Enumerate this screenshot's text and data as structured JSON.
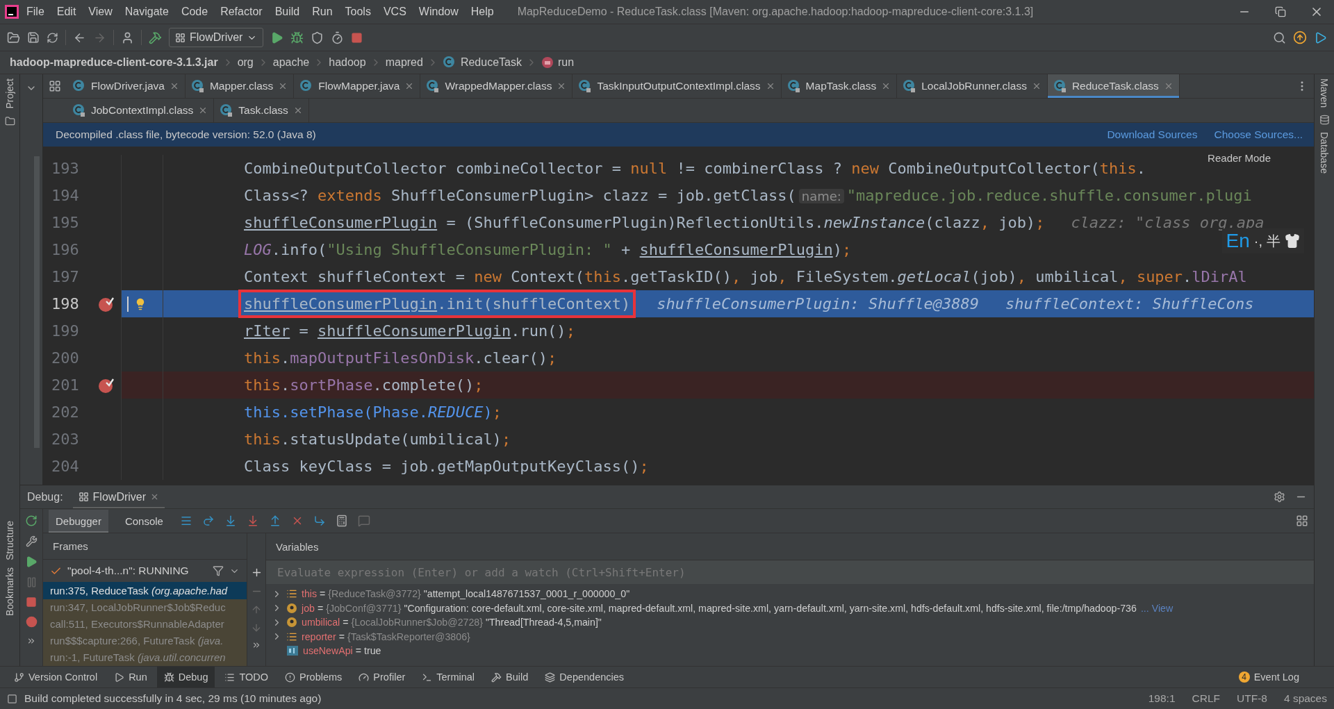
{
  "window": {
    "title": "MapReduceDemo - ReduceTask.class [Maven: org.apache.hadoop:hadoop-mapreduce-client-core:3.1.3]"
  },
  "menu": [
    "File",
    "Edit",
    "View",
    "Navigate",
    "Code",
    "Refactor",
    "Build",
    "Run",
    "Tools",
    "VCS",
    "Window",
    "Help"
  ],
  "toolbar": {
    "run_config": "FlowDriver"
  },
  "breadcrumb": [
    {
      "text": "hadoop-mapreduce-client-core-3.1.3.jar",
      "kind": "jar"
    },
    {
      "text": "org",
      "kind": "package"
    },
    {
      "text": "apache",
      "kind": "package"
    },
    {
      "text": "hadoop",
      "kind": "package"
    },
    {
      "text": "mapred",
      "kind": "package"
    },
    {
      "text": "ReduceTask",
      "kind": "class"
    },
    {
      "text": "run",
      "kind": "method"
    }
  ],
  "tab_rows": [
    [
      {
        "label": "FlowDriver.java",
        "kind": "java",
        "selected": false
      },
      {
        "label": "Mapper.class",
        "kind": "class",
        "selected": false
      },
      {
        "label": "FlowMapper.java",
        "kind": "java",
        "selected": false
      },
      {
        "label": "WrappedMapper.class",
        "kind": "class",
        "selected": false
      },
      {
        "label": "TaskInputOutputContextImpl.class",
        "kind": "class",
        "selected": false
      },
      {
        "label": "MapTask.class",
        "kind": "class",
        "selected": false
      },
      {
        "label": "LocalJobRunner.class",
        "kind": "class",
        "selected": false
      },
      {
        "label": "ReduceTask.class",
        "kind": "class",
        "selected": true
      }
    ],
    [
      {
        "label": "JobContextImpl.class",
        "kind": "class",
        "selected": false
      },
      {
        "label": "Task.class",
        "kind": "class",
        "selected": false
      }
    ]
  ],
  "banner": {
    "text": "Decompiled .class file, bytecode version: 52.0 (Java 8)",
    "links": [
      "Download Sources",
      "Choose Sources..."
    ]
  },
  "left_strip": {
    "top": [
      "Project"
    ],
    "bottom": [
      "Structure",
      "Bookmarks"
    ]
  },
  "right_strip": [
    "Maven",
    "Database"
  ],
  "editor": {
    "reader_mode": "Reader Mode",
    "lines": [
      {
        "number": "193",
        "breakpoint": false,
        "current": false,
        "boxed": false,
        "tokens": [
          {
            "kind": "plain",
            "text": "CombineOutputCollector combineCollector = "
          },
          {
            "kind": "keyword",
            "text": "null"
          },
          {
            "kind": "plain",
            "text": " != combinerClass ? "
          },
          {
            "kind": "keyword",
            "text": "new"
          },
          {
            "kind": "plain",
            "text": " CombineOutputCollector("
          },
          {
            "kind": "keyword",
            "text": "this"
          },
          {
            "kind": "plain",
            "text": "."
          }
        ]
      },
      {
        "number": "194",
        "breakpoint": false,
        "current": false,
        "boxed": false,
        "tokens": [
          {
            "kind": "plain",
            "text": "Class<? "
          },
          {
            "kind": "keyword",
            "text": "extends"
          },
          {
            "kind": "plain",
            "text": " ShuffleConsumerPlugin> clazz = job.getClass("
          },
          {
            "kind": "hint",
            "text": "name:"
          },
          {
            "kind": "string",
            "text": "\"mapreduce.job.reduce.shuffle.consumer.plugi"
          }
        ]
      },
      {
        "number": "195",
        "breakpoint": false,
        "current": false,
        "boxed": false,
        "tokens": [
          {
            "kind": "underlined",
            "text": "shuffleConsumerPlugin"
          },
          {
            "kind": "plain",
            "text": " = (ShuffleConsumerPlugin)ReflectionUtils."
          },
          {
            "kind": "italic",
            "text": "newInstance"
          },
          {
            "kind": "plain",
            "text": "(clazz"
          },
          {
            "kind": "keyword",
            "text": ","
          },
          {
            "kind": "plain",
            "text": " job)"
          },
          {
            "kind": "keyword",
            "text": ";"
          }
        ],
        "hints": [
          "clazz: \"class org.apa"
        ]
      },
      {
        "number": "196",
        "breakpoint": false,
        "current": false,
        "boxed": false,
        "tokens": [
          {
            "kind": "static",
            "text": "LOG"
          },
          {
            "kind": "plain",
            "text": ".info("
          },
          {
            "kind": "string",
            "text": "\"Using ShuffleConsumerPlugin: \""
          },
          {
            "kind": "plain",
            "text": " + "
          },
          {
            "kind": "underlined",
            "text": "shuffleConsumerPlugin"
          },
          {
            "kind": "plain",
            "text": ")"
          },
          {
            "kind": "keyword",
            "text": ";"
          }
        ]
      },
      {
        "number": "197",
        "breakpoint": false,
        "current": false,
        "boxed": false,
        "tokens": [
          {
            "kind": "plain",
            "text": "Context shuffleContext = "
          },
          {
            "kind": "keyword",
            "text": "new"
          },
          {
            "kind": "plain",
            "text": " Context("
          },
          {
            "kind": "keyword",
            "text": "this"
          },
          {
            "kind": "plain",
            "text": ".getTaskID()"
          },
          {
            "kind": "keyword",
            "text": ","
          },
          {
            "kind": "plain",
            "text": " job"
          },
          {
            "kind": "keyword",
            "text": ","
          },
          {
            "kind": "plain",
            "text": " FileSystem."
          },
          {
            "kind": "italic",
            "text": "getLocal"
          },
          {
            "kind": "plain",
            "text": "(job)"
          },
          {
            "kind": "keyword",
            "text": ","
          },
          {
            "kind": "plain",
            "text": " umbilical"
          },
          {
            "kind": "keyword",
            "text": ", super"
          },
          {
            "kind": "plain",
            "text": "."
          },
          {
            "kind": "field",
            "text": "lDirAl"
          }
        ]
      },
      {
        "number": "198",
        "breakpoint": true,
        "current": true,
        "boxed": true,
        "tokens": [
          {
            "kind": "underlined",
            "text": "shuffleConsumerPlugin"
          },
          {
            "kind": "plain",
            "text": ".init(shuffleContext)"
          }
        ],
        "hints": [
          "shuffleConsumerPlugin: Shuffle@3889",
          "shuffleContext: ShuffleCons"
        ]
      },
      {
        "number": "199",
        "breakpoint": false,
        "current": false,
        "boxed": false,
        "tokens": [
          {
            "kind": "underlined",
            "text": "rIter"
          },
          {
            "kind": "plain",
            "text": " = "
          },
          {
            "kind": "underlined",
            "text": "shuffleConsumerPlugin"
          },
          {
            "kind": "plain",
            "text": ".run()"
          },
          {
            "kind": "keyword",
            "text": ";"
          }
        ]
      },
      {
        "number": "200",
        "breakpoint": false,
        "current": false,
        "boxed": false,
        "tokens": [
          {
            "kind": "keyword",
            "text": "this"
          },
          {
            "kind": "plain",
            "text": "."
          },
          {
            "kind": "field",
            "text": "mapOutputFilesOnDisk"
          },
          {
            "kind": "plain",
            "text": ".clear()"
          },
          {
            "kind": "keyword",
            "text": ";"
          }
        ]
      },
      {
        "number": "201",
        "breakpoint": true,
        "current": false,
        "boxed": false,
        "tokens": [
          {
            "kind": "keyword",
            "text": "this"
          },
          {
            "kind": "plain",
            "text": "."
          },
          {
            "kind": "field",
            "text": "sortPhase"
          },
          {
            "kind": "plain",
            "text": ".complete()"
          },
          {
            "kind": "keyword",
            "text": ";"
          }
        ]
      },
      {
        "number": "202",
        "breakpoint": false,
        "current": false,
        "boxed": false,
        "tokens": [
          {
            "kind": "blue",
            "text": "this.setPhase(Phase."
          },
          {
            "kind": "blueitalic",
            "text": "REDUCE"
          },
          {
            "kind": "blue",
            "text": ")"
          },
          {
            "kind": "keyword",
            "text": ";"
          }
        ]
      },
      {
        "number": "203",
        "breakpoint": false,
        "current": false,
        "boxed": false,
        "tokens": [
          {
            "kind": "keyword",
            "text": "this"
          },
          {
            "kind": "plain",
            "text": ".statusUpdate(umbilical)"
          },
          {
            "kind": "keyword",
            "text": ";"
          }
        ]
      },
      {
        "number": "204",
        "breakpoint": false,
        "current": false,
        "boxed": false,
        "tokens": [
          {
            "kind": "plain",
            "text": "Class keyClass = job.getMapOutputKeyClass()"
          },
          {
            "kind": "keyword",
            "text": ";"
          }
        ]
      }
    ]
  },
  "ime": {
    "lang": "En",
    "punct": "·,",
    "width": "半"
  },
  "debug": {
    "label": "Debug:",
    "session": "FlowDriver",
    "tabs": [
      {
        "label": "Debugger",
        "selected": true
      },
      {
        "label": "Console",
        "selected": false
      }
    ],
    "frames": {
      "title": "Frames",
      "thread": "\"pool-4-th...n\": RUNNING",
      "items": [
        {
          "method": "run:375, ReduceTask",
          "package": "(org.apache.had",
          "selected": true,
          "library": false
        },
        {
          "method": "run:347, LocalJobRunner$Job$Reduc",
          "selected": false,
          "library": true
        },
        {
          "method": "call:511, Executors$RunnableAdapter",
          "selected": false,
          "library": true
        },
        {
          "method": "run$$$capture:266, FutureTask",
          "package": "(java.",
          "selected": false,
          "library": true
        },
        {
          "method": "run:-1, FutureTask",
          "package": "(java.util.concurren",
          "selected": false,
          "library": true
        }
      ]
    },
    "variables": {
      "title": "Variables",
      "placeholder": "Evaluate expression (Enter) or add a watch (Ctrl+Shift+Enter)",
      "items": [
        {
          "name": "this",
          "op": "=",
          "kind": "field",
          "expandable": true,
          "type": "{ReduceTask@3772}",
          "value": "\"attempt_local1487671537_0001_r_000000_0\""
        },
        {
          "name": "job",
          "op": "=",
          "kind": "param",
          "expandable": true,
          "type": "{JobConf@3771}",
          "value": "\"Configuration: core-default.xml, core-site.xml, mapred-default.xml, mapred-site.xml, yarn-default.xml, yarn-site.xml, hdfs-default.xml, hdfs-site.xml, file:/tmp/hadoop-736",
          "link": "... View"
        },
        {
          "name": "umbilical",
          "op": "=",
          "kind": "param",
          "expandable": true,
          "type": "{LocalJobRunner$Job@2728}",
          "value": "\"Thread[Thread-4,5,main]\""
        },
        {
          "name": "reporter",
          "op": "=",
          "kind": "field",
          "expandable": true,
          "type": "{Task$TaskReporter@3806}"
        },
        {
          "name": "useNewApi",
          "op": "=",
          "kind": "primitive",
          "expandable": false,
          "value": "true"
        }
      ]
    }
  },
  "bottom_tools": [
    {
      "label": "Version Control",
      "selected": false
    },
    {
      "label": "Run",
      "selected": false
    },
    {
      "label": "Debug",
      "selected": true
    },
    {
      "label": "TODO",
      "selected": false
    },
    {
      "label": "Problems",
      "selected": false
    },
    {
      "label": "Profiler",
      "selected": false
    },
    {
      "label": "Terminal",
      "selected": false
    },
    {
      "label": "Build",
      "selected": false
    },
    {
      "label": "Dependencies",
      "selected": false
    }
  ],
  "event_log": {
    "label": "Event Log",
    "count": "4"
  },
  "status_bar": {
    "message": "Build completed successfully in 4 sec, 29 ms (10 minutes ago)",
    "items": [
      "198:1",
      "CRLF",
      "UTF-8",
      "4 spaces"
    ]
  }
}
